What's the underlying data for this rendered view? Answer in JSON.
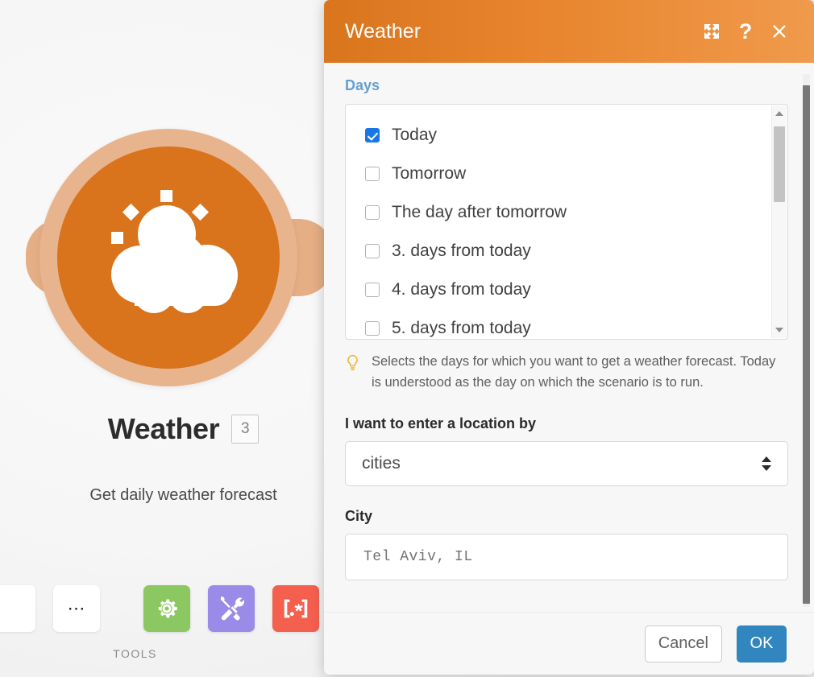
{
  "colors": {
    "header_gradient_start": "#d9751d",
    "header_gradient_end": "#f09a4c",
    "node_circle": "#d9731c",
    "node_ring": "#e8b48e",
    "label_blue": "#64a0cf",
    "checkbox_blue": "#1877e8",
    "ok_button_blue": "#3286bf",
    "bulb_yellow": "#f2b83e",
    "tool_green": "#8cc861",
    "tool_purple": "#9b8be8",
    "tool_red": "#f45f4e"
  },
  "node": {
    "title": "Weather",
    "badge": "3",
    "subtitle": "Get daily weather forecast",
    "icon": "sun-behind-cloud-icon",
    "tools_label": "TOOLS",
    "more_tile": "…",
    "tools": [
      {
        "name": "gear-tool",
        "icon": "gear-icon",
        "color": "#8cc861"
      },
      {
        "name": "screwdriver-wrench-tool",
        "icon": "screwdriver-wrench-icon",
        "color": "#9b8be8"
      },
      {
        "name": "regex-tool",
        "icon": "regex-brackets-icon",
        "label": "[.*]",
        "color": "#f45f4e"
      }
    ]
  },
  "dialog": {
    "title": "Weather",
    "header_buttons": [
      {
        "name": "expand-button",
        "icon": "expand-arrows-icon"
      },
      {
        "name": "help-button",
        "icon": "question-mark-icon",
        "glyph": "?"
      },
      {
        "name": "close-button",
        "icon": "close-icon",
        "glyph": "×"
      }
    ],
    "days": {
      "label": "Days",
      "items": [
        {
          "label": "Today",
          "checked": true
        },
        {
          "label": "Tomorrow",
          "checked": false
        },
        {
          "label": "The day after tomorrow",
          "checked": false
        },
        {
          "label": "3. days from today",
          "checked": false
        },
        {
          "label": "4. days from today",
          "checked": false
        },
        {
          "label": "5. days from today",
          "checked": false
        }
      ],
      "hint": "Selects the days for which you want to get a weather forecast. Today is understood as the day on which the scenario is to run.",
      "hint_icon": "lightbulb-icon"
    },
    "location": {
      "label": "I want to enter a location by",
      "selected": "cities"
    },
    "city": {
      "label": "City",
      "value": "Tel Aviv, IL"
    },
    "footer": {
      "cancel_label": "Cancel",
      "ok_label": "OK"
    }
  }
}
